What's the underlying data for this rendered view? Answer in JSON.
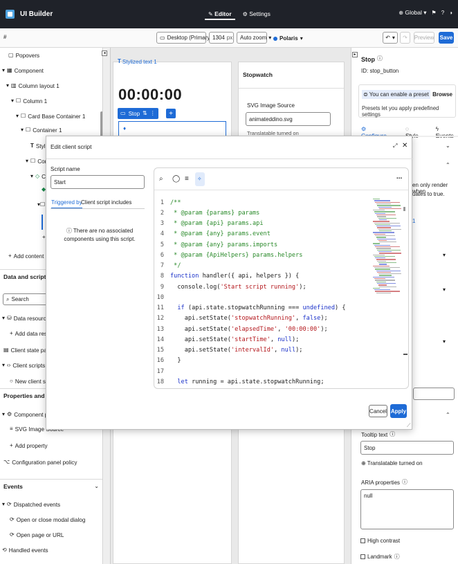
{
  "app": {
    "title": "UI Builder",
    "tabs": [
      "Editor",
      "Settings"
    ],
    "scope": "Global ▾"
  },
  "toolbar": {
    "device": "Desktop (Primary)*",
    "width_value": "1304",
    "width_unit": "px",
    "zoom": "Auto zoom",
    "theme": "Polaris",
    "preview_label": "Preview",
    "save_label": "Save"
  },
  "left_panel": {
    "tree": [
      "Popovers",
      "Component",
      "Column layout 1",
      "Column 1",
      "Card Base Container 1",
      "Container 1",
      "Styliz",
      "Conta",
      "Co"
    ],
    "add_content": "Add content",
    "data_scripts": {
      "heading": "Data and scripts",
      "search_placeholder": "Search",
      "items": [
        "Data resources",
        "Add data resource",
        "Client state parameter",
        "Client scripts",
        "New client script"
      ]
    },
    "properties": {
      "heading": "Properties and policy",
      "items": [
        "Component proper",
        "SVG Image Source",
        "Add property",
        "Configuration panel policy"
      ]
    },
    "events": {
      "heading": "Events",
      "items": [
        "Dispatched events",
        "Open or close modal dialog",
        "Open page or URL",
        "Handled events"
      ]
    }
  },
  "canvas": {
    "stylized_tag": "Stylized text 1",
    "clock": "00:00:00",
    "stop_chip": "Stop",
    "stopwatch_label": "Stopwatch",
    "svg_label": "SVG Image Source",
    "svg_value": "animateddino.svg",
    "svg_note": "Translatable turned on"
  },
  "right_panel": {
    "title": "Stop",
    "id_label": "ID: stop_button",
    "preset_text": "You can enable a preset",
    "browse_label": "Browse",
    "preset_help": "Presets let you apply predefined settings",
    "tabs": [
      "Configure",
      "Style",
      "Events"
    ],
    "partial_text_1": "en only render when",
    "partial_text_2": "uates to true.",
    "partial_num": "1",
    "tooltip_label": "Tooltip text",
    "tooltip_value": "Stop",
    "translatable_note": "Translatable turned on",
    "aria_label": "ARIA properties",
    "aria_value": "null",
    "high_contrast": "High contrast",
    "landmark": "Landmark"
  },
  "modal": {
    "title": "Edit client script",
    "script_name_label": "Script name",
    "script_name_value": "Start",
    "tabs": [
      "Triggered by",
      "Client script includes"
    ],
    "empty_message": "There are no associated components using this script.",
    "cancel_label": "Cancel",
    "apply_label": "Apply",
    "code": {
      "line_numbers": [
        "1",
        "2",
        "3",
        "4",
        "5",
        "6",
        "7",
        "8",
        "9",
        "10",
        "11",
        "12",
        "13",
        "14",
        "15",
        "16",
        "17",
        "18"
      ],
      "lines": [
        "/**",
        " * @param {params} params",
        " * @param {api} params.api",
        " * @param {any} params.event",
        " * @param {any} params.imports",
        " * @param {ApiHelpers} params.helpers",
        " */",
        "function handler({ api, helpers }) {",
        "  console.log('Start script running');",
        "",
        "  if (api.state.stopwatchRunning === undefined) {",
        "    api.setState('stopwatchRunning', false);",
        "    api.setState('elapsedTime', '00:00:00');",
        "    api.setState('startTime', null);",
        "    api.setState('intervalId', null);",
        "  }",
        "",
        "  let running = api.state.stopwatchRunning;"
      ]
    }
  },
  "colors": {
    "topbar": "#1f2229",
    "accent": "#1e6bd6",
    "comment": "#2a8a2a",
    "keyword": "#1a31c9",
    "string": "#b3161b"
  }
}
